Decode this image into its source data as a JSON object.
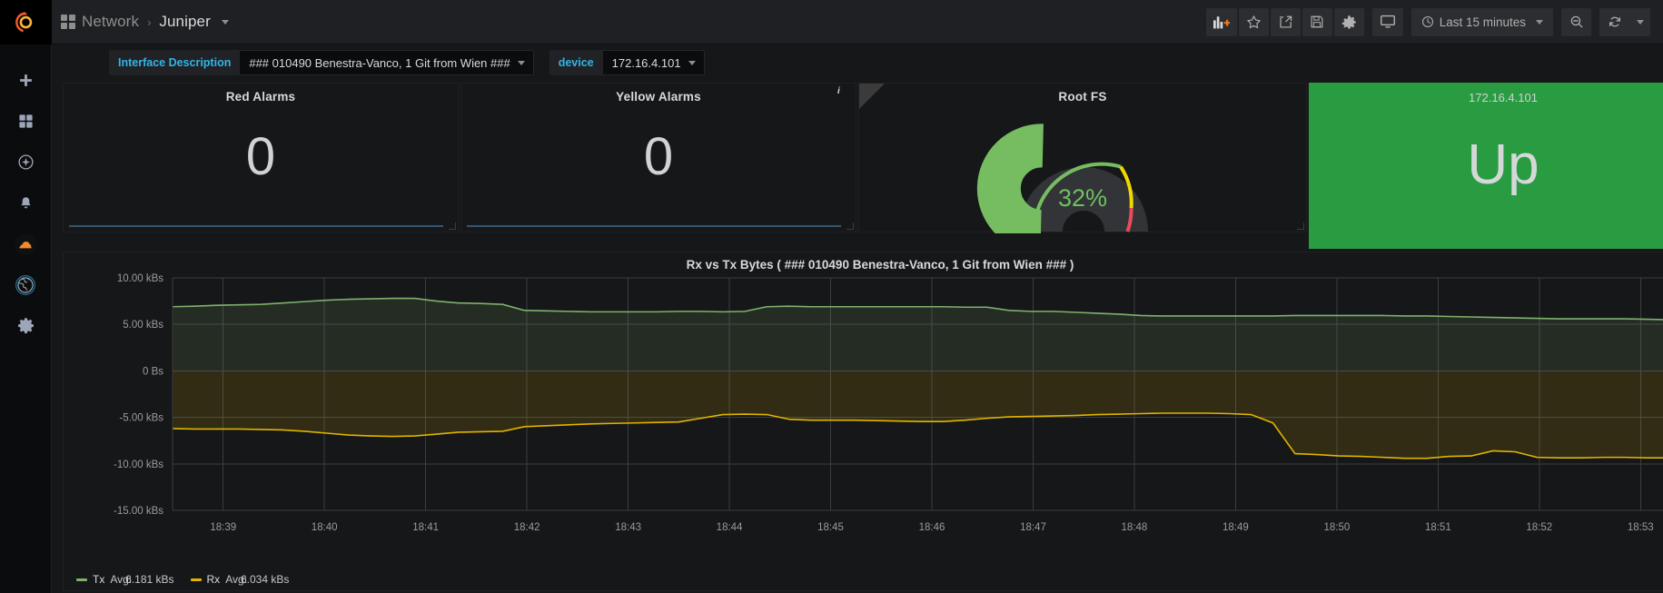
{
  "brand": {
    "logo_icon": "grafana-logo-icon"
  },
  "sidebar": {
    "items": [
      {
        "name": "create-add",
        "icon": "plus-icon"
      },
      {
        "name": "dashboards",
        "icon": "apps-grid-icon"
      },
      {
        "name": "explore",
        "icon": "compass-icon"
      },
      {
        "name": "alerting",
        "icon": "bell-icon"
      },
      {
        "name": "cloud",
        "icon": "cloud-icon"
      },
      {
        "name": "server-admin",
        "icon": "globe-icon"
      },
      {
        "name": "configuration",
        "icon": "gear-icon"
      }
    ]
  },
  "navbar": {
    "breadcrumb_folder": "Network",
    "breadcrumb_separator": "›",
    "dashboard_title": "Juniper",
    "buttons": [
      {
        "name": "add-panel-button",
        "icon": "add-panel-icon"
      },
      {
        "name": "mark-favorite-button",
        "icon": "star-icon"
      },
      {
        "name": "share-dashboard-button",
        "icon": "share-icon"
      },
      {
        "name": "save-dashboard-button",
        "icon": "save-disk-icon"
      },
      {
        "name": "dashboard-settings-button",
        "icon": "gear-icon"
      },
      {
        "name": "cycle-view-mode-button",
        "icon": "monitor-icon"
      }
    ],
    "time_range": "Last 15 minutes",
    "zoom_out_icon": "search-minus-icon",
    "refresh_icon": "refresh-icon"
  },
  "variables": [
    {
      "name": "interface-description",
      "label": "Interface Description",
      "value": "### 010490 Benestra-Vanco, 1 Git from Wien ###"
    },
    {
      "name": "device",
      "label": "device",
      "value": "172.16.4.101"
    }
  ],
  "panels": {
    "red_alarms": {
      "title": "Red Alarms",
      "value": "0"
    },
    "yellow_alarms": {
      "title": "Yellow Alarms",
      "value": "0"
    },
    "root_fs": {
      "title": "Root FS",
      "value": "32%",
      "percent": 32,
      "value_color": "#6fbf62",
      "info_marker": "i"
    },
    "interface_status": {
      "title": "172.16.4.101",
      "value": "Up",
      "background_color": "#299c42"
    }
  },
  "chart_data": {
    "type": "area",
    "title": "Rx vs Tx Bytes ( ### 010490 Benestra-Vanco, 1 Git from Wien ### )",
    "xlabel": "",
    "ylabel": "",
    "grid": true,
    "legend_position": "bottom-left",
    "ylim": [
      -15000,
      10000
    ],
    "ytick_labels": [
      "10.00 kBs",
      "5.00 kBs",
      "0 Bs",
      "-5.00 kBs",
      "-10.00 kBs",
      "-15.00 kBs"
    ],
    "ytick_values": [
      10000,
      5000,
      0,
      -5000,
      -10000,
      -15000
    ],
    "xtick_labels": [
      "18:39",
      "18:40",
      "18:41",
      "18:42",
      "18:43",
      "18:44",
      "18:45",
      "18:46",
      "18:47",
      "18:48",
      "18:49",
      "18:50",
      "18:51",
      "18:52",
      "18:53"
    ],
    "series": [
      {
        "name": "Tx",
        "color": "#7eb26d",
        "stat_label": "Avg:",
        "stat_value": "6.181 kBs",
        "values": [
          6900,
          6950,
          7050,
          7100,
          7150,
          7300,
          7450,
          7600,
          7700,
          7750,
          7800,
          7800,
          7500,
          7300,
          7250,
          7150,
          6500,
          6450,
          6400,
          6350,
          6350,
          6350,
          6350,
          6400,
          6400,
          6350,
          6400,
          6900,
          6950,
          6900,
          6900,
          6900,
          6900,
          6900,
          6900,
          6900,
          6850,
          6850,
          6500,
          6400,
          6400,
          6300,
          6200,
          6100,
          5950,
          5900,
          5900,
          5900,
          5900,
          5900,
          5900,
          5950,
          5950,
          5950,
          5950,
          5950,
          5900,
          5900,
          5850,
          5800,
          5750,
          5700,
          5650,
          5600,
          5600,
          5600,
          5600,
          5550,
          5500,
          5450
        ]
      },
      {
        "name": "Rx",
        "color": "#e0b400",
        "stat_label": "Avg:",
        "stat_value": "6.034 kBs",
        "values": [
          -6200,
          -6250,
          -6250,
          -6250,
          -6300,
          -6350,
          -6500,
          -6700,
          -6900,
          -7000,
          -7050,
          -7000,
          -6800,
          -6600,
          -6550,
          -6500,
          -6000,
          -5900,
          -5800,
          -5700,
          -5650,
          -5600,
          -5550,
          -5500,
          -5100,
          -4700,
          -4650,
          -4700,
          -5200,
          -5300,
          -5300,
          -5300,
          -5350,
          -5400,
          -5450,
          -5450,
          -5300,
          -5100,
          -4950,
          -4900,
          -4850,
          -4800,
          -4700,
          -4650,
          -4600,
          -4550,
          -4550,
          -4550,
          -4600,
          -4700,
          -5600,
          -8900,
          -9000,
          -9150,
          -9200,
          -9300,
          -9400,
          -9400,
          -9200,
          -9150,
          -8600,
          -8700,
          -9300,
          -9350,
          -9350,
          -9300,
          -9300,
          -9350,
          -9350,
          -9300
        ]
      }
    ]
  }
}
